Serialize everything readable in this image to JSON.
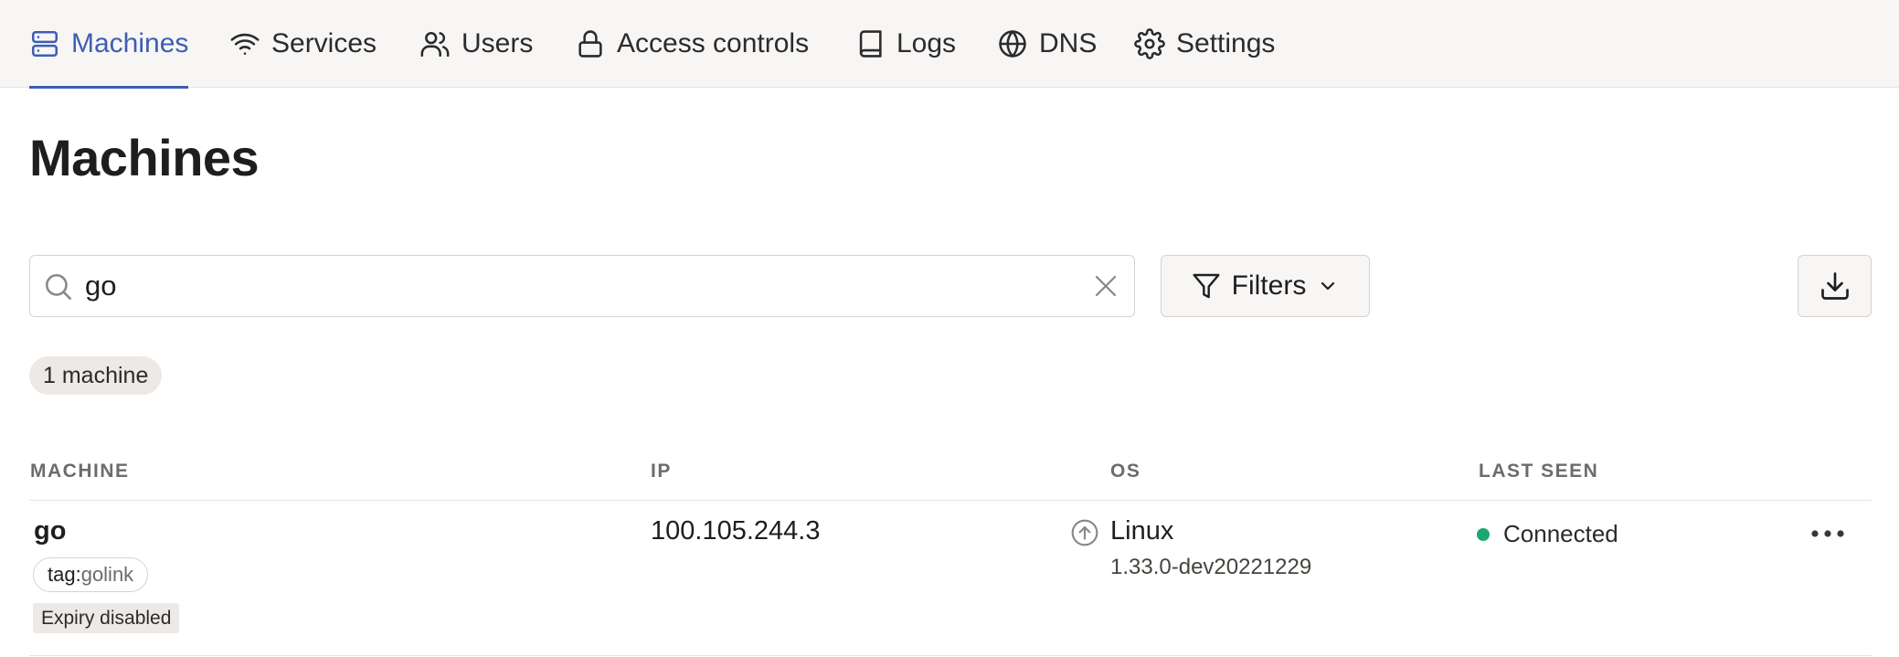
{
  "nav": {
    "items": [
      {
        "label": "Machines",
        "icon": "machines-icon",
        "active": true
      },
      {
        "label": "Services",
        "icon": "wifi-icon"
      },
      {
        "label": "Users",
        "icon": "users-icon"
      },
      {
        "label": "Access controls",
        "icon": "lock-icon"
      },
      {
        "label": "Logs",
        "icon": "book-icon"
      },
      {
        "label": "DNS",
        "icon": "globe-icon"
      },
      {
        "label": "Settings",
        "icon": "gear-icon"
      }
    ]
  },
  "page": {
    "title": "Machines"
  },
  "toolbar": {
    "search_value": "go",
    "filters_label": "Filters"
  },
  "count_label": "1 machine",
  "table": {
    "columns": [
      "MACHINE",
      "IP",
      "OS",
      "LAST SEEN"
    ],
    "rows": [
      {
        "name": "go",
        "tag_key": "tag:",
        "tag_value": "golink",
        "expiry": "Expiry disabled",
        "ip": "100.105.244.3",
        "os": "Linux",
        "os_version": "1.33.0-dev20221229",
        "last_seen": "Connected"
      }
    ]
  },
  "colors": {
    "accent": "#3f5db3",
    "connected": "#1da672",
    "nav_bg": "#f7f6f5"
  }
}
